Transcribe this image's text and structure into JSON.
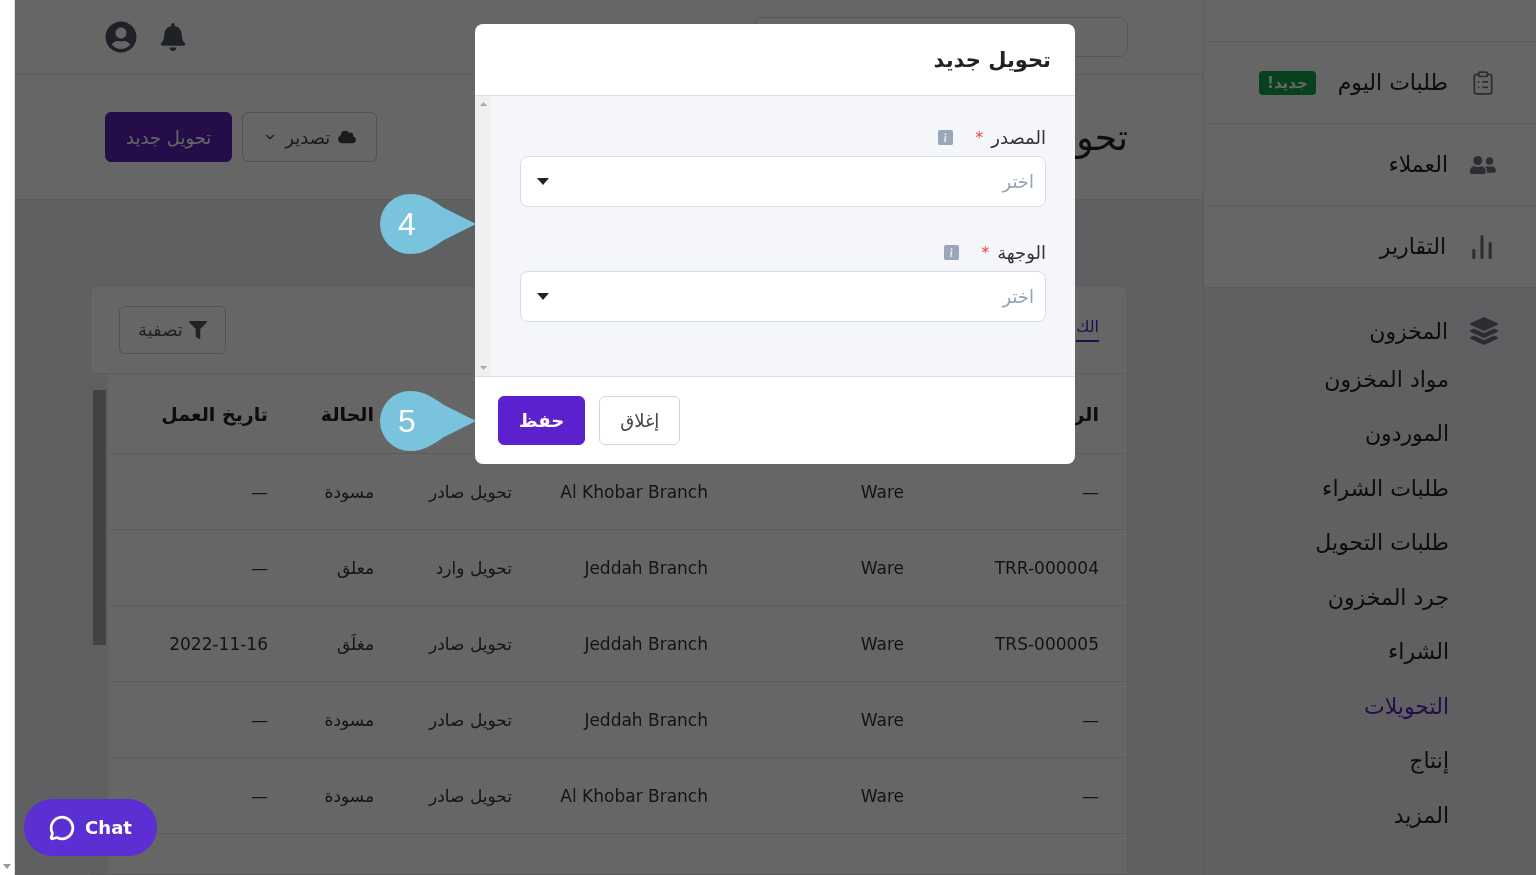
{
  "header": {
    "page_title": "تحو",
    "actions": [
      {
        "label": "تصدير",
        "kind": "menu"
      },
      {
        "label": "تحويل جديد",
        "kind": "primary"
      }
    ]
  },
  "card": {
    "tabs": [
      {
        "label": "الك",
        "selected": true
      }
    ],
    "filter_button": "تصفية",
    "table": {
      "columns": [
        {
          "label": "الر"
        },
        {},
        {},
        {},
        {
          "label": "الحالة"
        },
        {
          "label": "تاريخ العمل"
        }
      ],
      "rows": [
        [
          "—",
          "Ware",
          "Al Khobar Branch",
          "تحويل صادر",
          "مسودة",
          "—"
        ],
        [
          "TRR-000004",
          "Ware",
          "Jeddah Branch",
          "تحويل وارد",
          "معلق",
          "—"
        ],
        [
          "TRS-000005",
          "Ware",
          "Jeddah Branch",
          "تحويل صادر",
          "مغلَق",
          "2022-11-16"
        ],
        [
          "—",
          "Ware",
          "Jeddah Branch",
          "تحويل صادر",
          "مسودة",
          "—"
        ],
        [
          "—",
          "Ware",
          "Al Khobar Branch",
          "تحويل صادر",
          "مسودة",
          "—"
        ]
      ]
    }
  },
  "sidebar": {
    "items": [
      {
        "label": "طلبات اليوم",
        "badge": "جديد!"
      },
      {
        "label": "العملاء"
      },
      {
        "label": "التقارير"
      }
    ],
    "section": {
      "label": "المخزون",
      "children": [
        {
          "label": "مواد المخزون",
          "selected": false
        },
        {
          "label": "الموردون",
          "selected": false
        },
        {
          "label": "طلبات الشراء",
          "selected": false
        },
        {
          "label": "طلبات التحويل",
          "selected": false
        },
        {
          "label": "جرد المخزون",
          "selected": false
        },
        {
          "label": "الشراء",
          "selected": false
        },
        {
          "label": "التحويلات",
          "selected": true
        },
        {
          "label": "إنتاج",
          "selected": false
        },
        {
          "label": "المزيد",
          "selected": false
        }
      ]
    }
  },
  "modal": {
    "title": "تحويل جديد",
    "fields": [
      {
        "label": "المصدر",
        "required_mark": "*",
        "placeholder": "اختر"
      },
      {
        "label": "الوجهة",
        "required_mark": "*",
        "placeholder": "اختر"
      }
    ],
    "buttons": [
      {
        "label": "إغلاق",
        "kind": "secondary"
      },
      {
        "label": "حفظ",
        "kind": "primary"
      }
    ]
  },
  "step_markers": [
    {
      "label": "4"
    },
    {
      "label": "5"
    }
  ],
  "chat_button": "Chat"
}
